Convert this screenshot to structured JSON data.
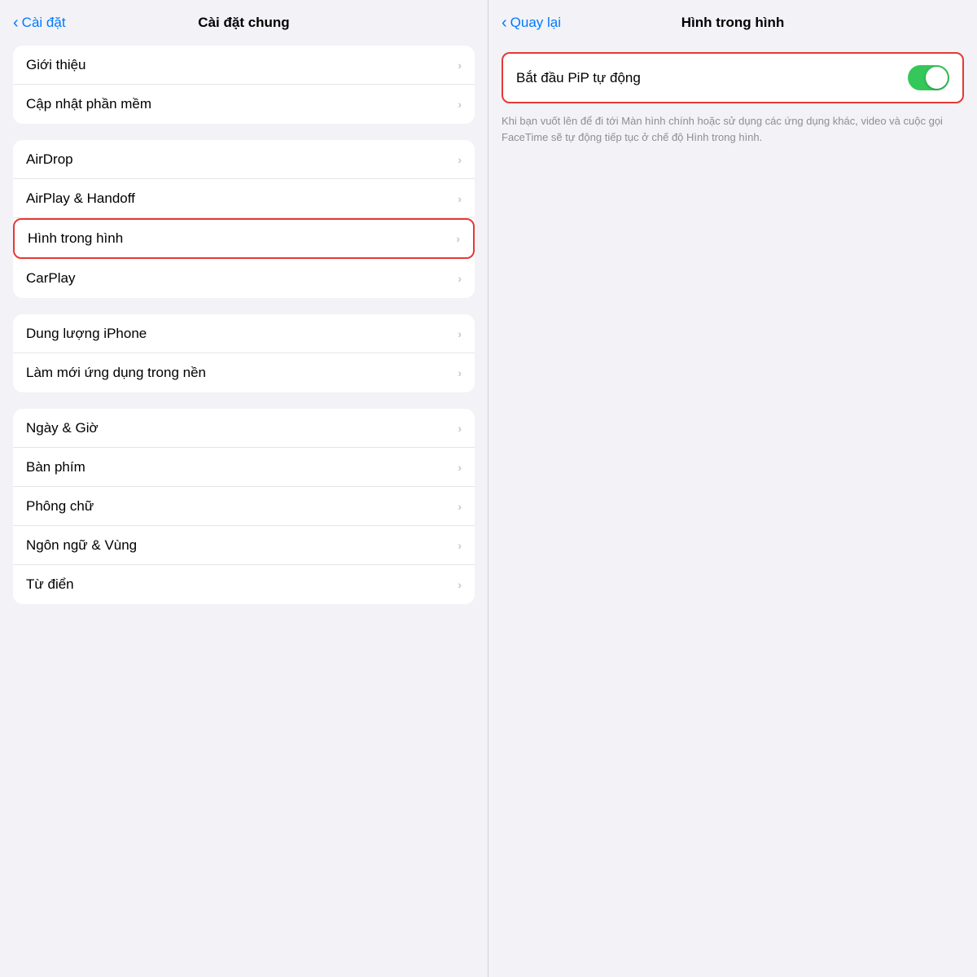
{
  "leftPanel": {
    "navBack": "Cài đặt",
    "navTitle": "Cài đặt chung",
    "sections": [
      {
        "id": "section1",
        "items": [
          {
            "id": "gioi-thieu",
            "label": "Giới thiệu",
            "highlighted": false
          },
          {
            "id": "cap-nhat",
            "label": "Cập nhật phần mềm",
            "highlighted": false
          }
        ]
      },
      {
        "id": "section2",
        "items": [
          {
            "id": "airdrop",
            "label": "AirDrop",
            "highlighted": false
          },
          {
            "id": "airplay",
            "label": "AirPlay & Handoff",
            "highlighted": false
          },
          {
            "id": "hinh-trong-hinh",
            "label": "Hình trong hình",
            "highlighted": true
          },
          {
            "id": "carplay",
            "label": "CarPlay",
            "highlighted": false
          }
        ]
      },
      {
        "id": "section3",
        "items": [
          {
            "id": "dung-luong",
            "label": "Dung lượng iPhone",
            "highlighted": false
          },
          {
            "id": "lam-moi",
            "label": "Làm mới ứng dụng trong nền",
            "highlighted": false
          }
        ]
      },
      {
        "id": "section4",
        "items": [
          {
            "id": "ngay-gio",
            "label": "Ngày & Giờ",
            "highlighted": false
          },
          {
            "id": "ban-phim",
            "label": "Bàn phím",
            "highlighted": false
          },
          {
            "id": "phong-chu",
            "label": "Phông chữ",
            "highlighted": false
          },
          {
            "id": "ngon-ngu",
            "label": "Ngôn ngữ & Vùng",
            "highlighted": false
          },
          {
            "id": "tu-dien",
            "label": "Từ điển",
            "highlighted": false
          }
        ]
      }
    ]
  },
  "rightPanel": {
    "navBack": "Quay lại",
    "navTitle": "Hình trong hình",
    "pip": {
      "label": "Bắt đầu PiP tự động",
      "toggleOn": true,
      "description": "Khi bạn vuốt lên để đi tới Màn hình chính hoặc sử dụng các ứng dụng khác, video và cuộc gọi FaceTime sẽ tự động tiếp tục ở chế độ Hình trong hình."
    }
  },
  "icons": {
    "chevronLeft": "‹",
    "chevronRight": "›"
  }
}
